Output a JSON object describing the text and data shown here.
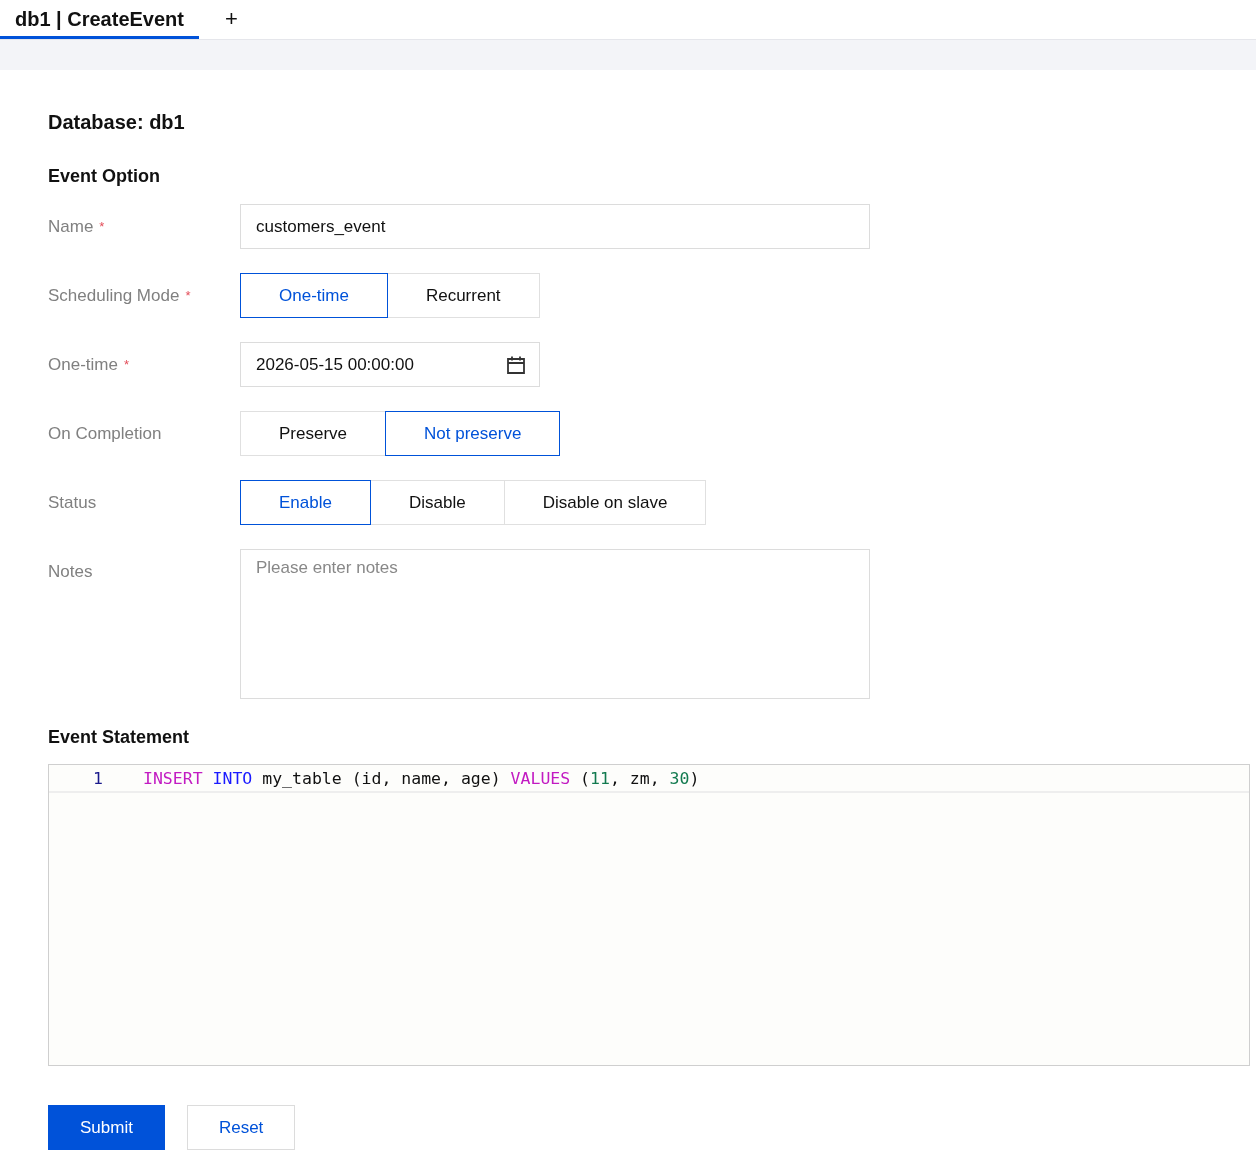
{
  "tabs": [
    {
      "label": "db1 | CreateEvent",
      "selected": true
    }
  ],
  "new_tab": "+",
  "database_heading": "Database: db1",
  "event_option_heading": "Event Option",
  "fields": [
    {
      "kind": "text",
      "label": "Name",
      "required_mark": "*",
      "value": "customers_event"
    },
    {
      "kind": "segmented",
      "label": "Scheduling Mode",
      "required_mark": "*",
      "options": [
        {
          "label": "One-time",
          "selected": true
        },
        {
          "label": "Recurrent",
          "selected": false
        }
      ]
    },
    {
      "kind": "date",
      "label": "One-time",
      "required_mark": "*",
      "value": "2026-05-15 00:00:00"
    },
    {
      "kind": "segmented",
      "label": "On Completion",
      "options": [
        {
          "label": "Preserve",
          "selected": false
        },
        {
          "label": "Not preserve",
          "selected": true
        }
      ]
    },
    {
      "kind": "segmented",
      "label": "Status",
      "options": [
        {
          "label": "Enable",
          "selected": true
        },
        {
          "label": "Disable",
          "selected": false
        },
        {
          "label": "Disable on slave",
          "selected": false
        }
      ]
    },
    {
      "kind": "textarea",
      "label": "Notes",
      "placeholder": "Please enter notes"
    }
  ],
  "statement_heading": "Event Statement",
  "editor": {
    "lines": [
      {
        "number": "1",
        "tokens": [
          {
            "text": "INSERT ",
            "kind": "keyword"
          },
          {
            "text": "INTO",
            "kind": "keyword2"
          },
          {
            "text": " my_table (id, name, age) ",
            "kind": "plain"
          },
          {
            "text": "VALUES",
            "kind": "keyword"
          },
          {
            "text": " (",
            "kind": "plain"
          },
          {
            "text": "11",
            "kind": "number"
          },
          {
            "text": ", zm, ",
            "kind": "plain"
          },
          {
            "text": "30",
            "kind": "number"
          },
          {
            "text": ")",
            "kind": "plain"
          }
        ]
      }
    ]
  },
  "buttons": [
    {
      "label": "Submit",
      "kind": "primary"
    },
    {
      "label": "Reset",
      "kind": "secondary"
    }
  ]
}
